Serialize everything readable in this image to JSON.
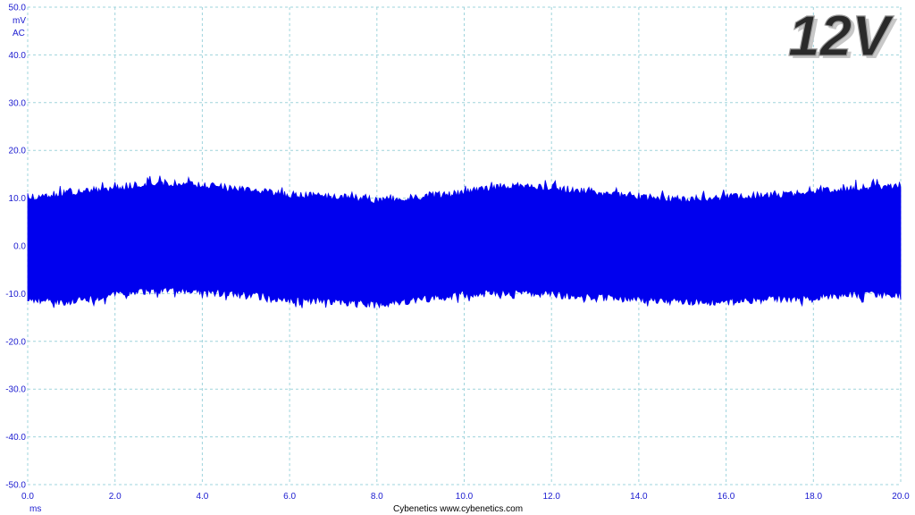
{
  "chart_data": {
    "type": "line",
    "title": "12V",
    "ylabel_unit": "mV",
    "ylabel_coupling": "AC",
    "xlabel": "ms",
    "footer": "Cybenetics   www.cybenetics.com",
    "xlim": [
      0,
      20
    ],
    "ylim": [
      -50,
      50
    ],
    "x_ticks": [
      "0.0",
      "2.0",
      "4.0",
      "6.0",
      "8.0",
      "10.0",
      "12.0",
      "14.0",
      "16.0",
      "18.0",
      "20.0"
    ],
    "y_ticks": [
      "50.0",
      "40.0",
      "30.0",
      "20.0",
      "10.0",
      "0.0",
      "-10.0",
      "-20.0",
      "-30.0",
      "-40.0",
      "-50.0"
    ],
    "grid": true,
    "series": [
      {
        "color": "#0000ee",
        "envelope_x": [
          0,
          1,
          2,
          3,
          4,
          5,
          6,
          7,
          8,
          9,
          10,
          11,
          12,
          13,
          14,
          15,
          16,
          17,
          18,
          19,
          20
        ],
        "envelope_upper": [
          11,
          12,
          13,
          14,
          13.5,
          12.5,
          11.5,
          11,
          10.5,
          11,
          12,
          13.5,
          13,
          12,
          11,
          10.5,
          11,
          11.5,
          12,
          13,
          13.5
        ],
        "envelope_lower": [
          -12,
          -12.5,
          -11,
          -10,
          -10.5,
          -11,
          -12,
          -12.5,
          -13,
          -12,
          -11,
          -10.5,
          -11,
          -11.5,
          -12,
          -12.5,
          -12.5,
          -12,
          -11.5,
          -11,
          -11
        ]
      }
    ]
  }
}
